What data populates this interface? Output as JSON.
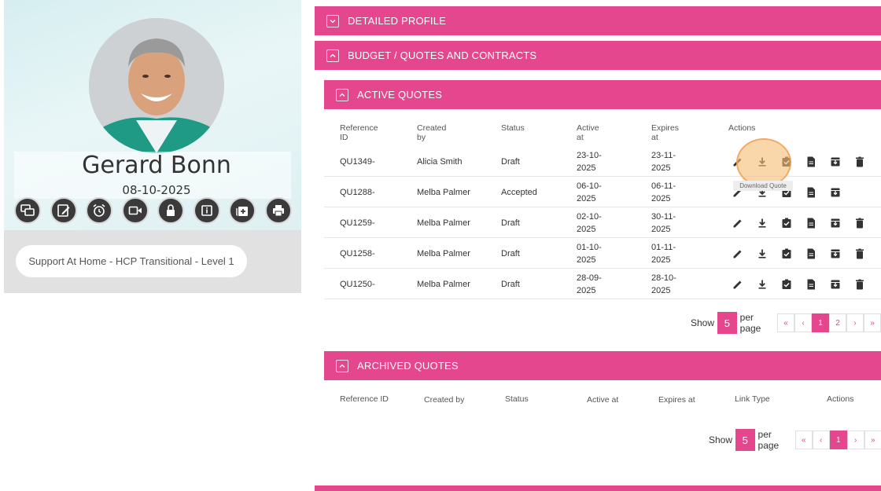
{
  "profile": {
    "name": "Gerard Bonn",
    "date": "08-10-2025",
    "plan": "Support At Home - HCP Transitional - Level 1",
    "action_icons": [
      "chat-icon",
      "edit-note-icon",
      "alarm-icon",
      "video-icon",
      "sync-lock-icon",
      "info-icon",
      "add-box-icon",
      "print-icon"
    ]
  },
  "sections": {
    "detailed_profile": "DETAILED PROFILE",
    "budget": "BUDGET / QUOTES AND CONTRACTS",
    "active_quotes": "ACTIVE QUOTES",
    "archived_quotes": "ARCHIVED QUOTES"
  },
  "active_table": {
    "headers": [
      "Reference ID",
      "Created by",
      "Status",
      "Active at",
      "Expires at",
      "Actions"
    ],
    "rows": [
      {
        "ref": "QU1349-",
        "created_by": "Alicia Smith",
        "status": "Draft",
        "active_at": "23-10-2025",
        "expires_at": "23-11-2025"
      },
      {
        "ref": "QU1288-",
        "created_by": "Melba Palmer",
        "status": "Accepted",
        "active_at": "06-10-2025",
        "expires_at": "06-11-2025"
      },
      {
        "ref": "QU1259-",
        "created_by": "Melba Palmer",
        "status": "Draft",
        "active_at": "02-10-2025",
        "expires_at": "30-11-2025"
      },
      {
        "ref": "QU1258-",
        "created_by": "Melba Palmer",
        "status": "Draft",
        "active_at": "01-10-2025",
        "expires_at": "01-11-2025"
      },
      {
        "ref": "QU1250-",
        "created_by": "Melba Palmer",
        "status": "Draft",
        "active_at": "28-09-2025",
        "expires_at": "28-10-2025"
      }
    ],
    "tooltip": "Download Quote"
  },
  "archived_table": {
    "headers": [
      "Reference ID",
      "Created by",
      "Status",
      "Active at",
      "Expires at",
      "Link Type",
      "Actions"
    ]
  },
  "pagination_active": {
    "show": "Show",
    "per_page_value": "5",
    "per_page": "per page",
    "pages": [
      "«",
      "‹",
      "1",
      "2",
      "›",
      "»"
    ],
    "current": "1"
  },
  "pagination_archived": {
    "show": "Show",
    "per_page_value": "5",
    "per_page": "per page",
    "pages": [
      "«",
      "‹",
      "1",
      "›",
      "»"
    ],
    "current": "1"
  },
  "colors": {
    "accent": "#e4478e",
    "dark_icon": "#3a3a3a"
  }
}
